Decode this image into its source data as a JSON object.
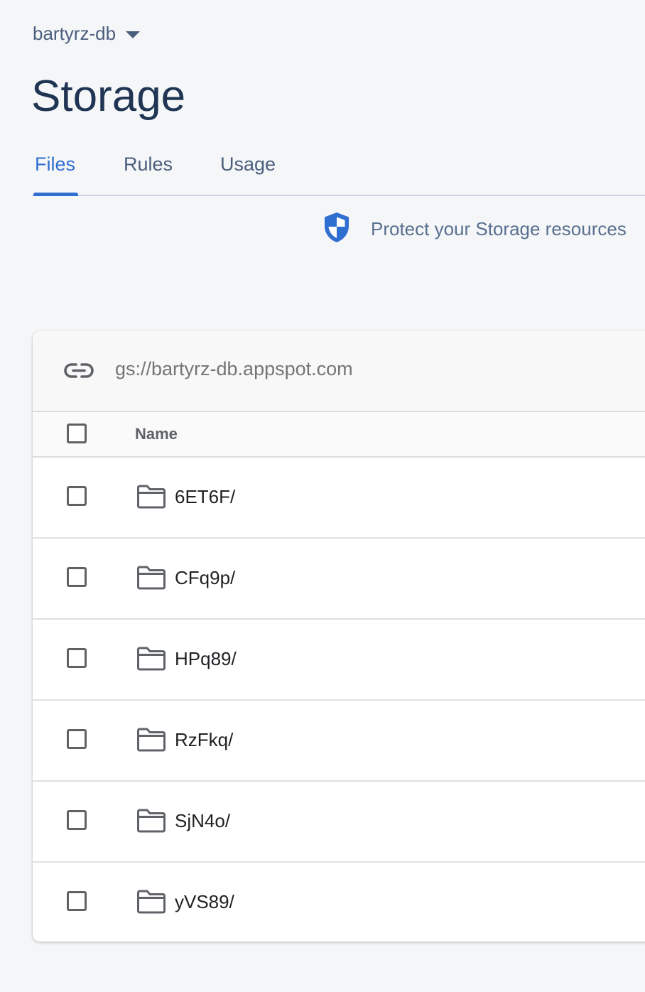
{
  "project": {
    "name": "bartyrz-db"
  },
  "page": {
    "title": "Storage"
  },
  "tabs": [
    {
      "label": "Files",
      "active": true
    },
    {
      "label": "Rules",
      "active": false
    },
    {
      "label": "Usage",
      "active": false
    }
  ],
  "notice": {
    "text": "Protect your Storage resources",
    "icon": "shield-icon"
  },
  "bucket": {
    "url": "gs://bartyrz-db.appspot.com",
    "icon": "link-icon"
  },
  "table": {
    "columns": [
      "Name"
    ],
    "rows": [
      {
        "name": "6ET6F/",
        "type": "folder"
      },
      {
        "name": "CFq9p/",
        "type": "folder"
      },
      {
        "name": "HPq89/",
        "type": "folder"
      },
      {
        "name": "RzFkq/",
        "type": "folder"
      },
      {
        "name": "SjN4o/",
        "type": "folder"
      },
      {
        "name": "yVS89/",
        "type": "folder"
      }
    ]
  },
  "colors": {
    "accent": "#2f6fd0",
    "title": "#1f3553",
    "background": "#f5f6f8"
  }
}
